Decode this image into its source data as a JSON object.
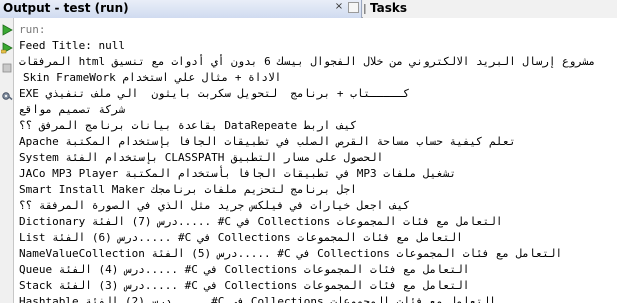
{
  "window": {
    "output_tab_title": "Output - test (run)",
    "tasks_tab_title": "Tasks",
    "close_glyph": "×",
    "minimize_glyph": "▭"
  },
  "toolbar": {
    "icons": [
      "rerun-icon",
      "rerun-with-args-icon",
      "stop-icon",
      "settings-icon"
    ]
  },
  "output": {
    "lines": [
      "run:",
      "Feed Title: null",
      "مشروع إرسال البريد الالكتروني من خلال الفجوال بيسك 6 بدون أي أدوات مع تنسيق html المرفقات",
      "الاداة + مثال علي استخدام Skin FrameWork",
      "كـــــتاب + برنامج  لتحويل سكربت بايثون  الي ملف تنفيذي EXE",
      "شركة تصميم مواقع",
      "كيف اربط DataRepeate بقاعدة بيانات برنامج المرفق ؟؟",
      "تعلم كيفية حساب مساحة القرص الصلب في تطبيقات الجافا بإستخدام المكتبة Apache",
      "الحصول على مسار التطبيق CLASSPATH بإستخدام الفئة System",
      "تشغيل ملفات MP3 في تطبيقات الجافا بأستخدام المكتبة JACo MP3 Player",
      "اجل برنامج لتحزيم ملفات برنامجك Smart Install Maker",
      "كيف اجعل خيارات في فيلكس جريد مثل الذي في الصورة المرفقة ؟؟",
      "التعامل مع فئات المجموعات Collections في C# .....درس (7) الفئة Dictionary",
      "التعامل مع فئات المجموعات Collections في C# .....درس (6) الفئة List",
      "التعامل مع فئات المجموعات Collections في C# .....درس (5) الفئة NameValueCollection",
      "التعامل مع فئات المجموعات Collections في C# .....درس (4) الفئة Queue",
      "التعامل مع فئات المجموعات Collections في C# .....درس (3) الفئة Stack",
      "التعامل مع فئات المجموعات Collections في C# .....درس (2) الفئة Hashtable"
    ]
  }
}
